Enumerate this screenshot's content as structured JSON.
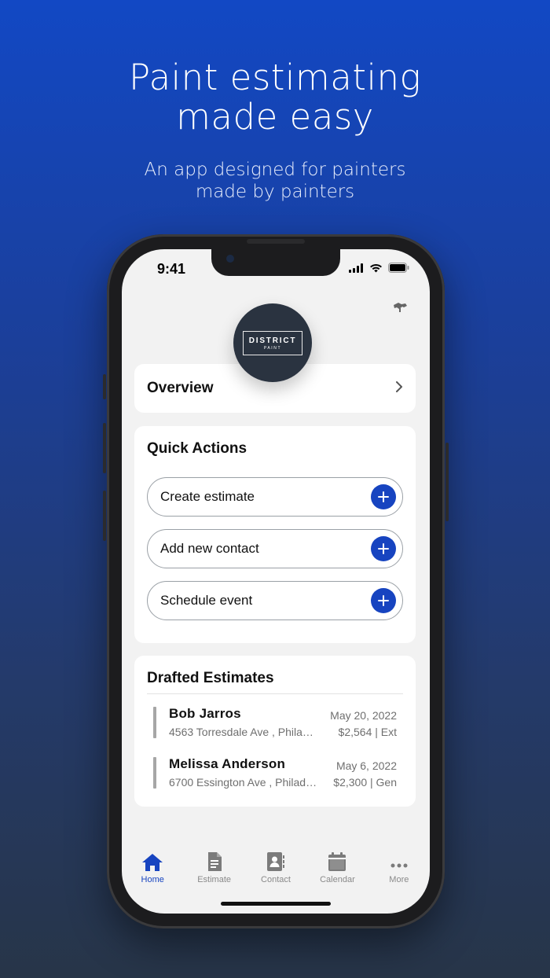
{
  "headline": {
    "line1": "Paint estimating",
    "line2": "made easy"
  },
  "subhead": {
    "line1": "An app designed for painters",
    "line2": "made by painters"
  },
  "status_bar": {
    "time": "9:41"
  },
  "logo": {
    "main": "DISTRICT",
    "sub": "PAINT"
  },
  "overview": {
    "title": "Overview"
  },
  "quick_actions": {
    "title": "Quick Actions",
    "items": [
      {
        "label": "Create estimate"
      },
      {
        "label": "Add new contact"
      },
      {
        "label": "Schedule event"
      }
    ]
  },
  "drafted_estimates": {
    "title": "Drafted Estimates",
    "items": [
      {
        "name": "Bob Jarros",
        "address": "4563 Torresdale Ave , Phila…",
        "date": "May 20, 2022",
        "amount": "$2,564 | Ext"
      },
      {
        "name": "Melissa Anderson",
        "address": "6700 Essington Ave , Philad…",
        "date": "May 6, 2022",
        "amount": "$2,300 | Gen"
      }
    ]
  },
  "tabbar": {
    "items": [
      {
        "label": "Home",
        "icon": "home-icon",
        "active": true
      },
      {
        "label": "Estimate",
        "icon": "document-icon"
      },
      {
        "label": "Contact",
        "icon": "contact-book-icon"
      },
      {
        "label": "Calendar",
        "icon": "calendar-icon"
      },
      {
        "label": "More",
        "icon": "more-dots-icon"
      }
    ]
  },
  "colors": {
    "accent": "#1744c0",
    "background_top": "#1248c4",
    "background_bottom": "#273548",
    "logo_bg": "#2a3340"
  }
}
